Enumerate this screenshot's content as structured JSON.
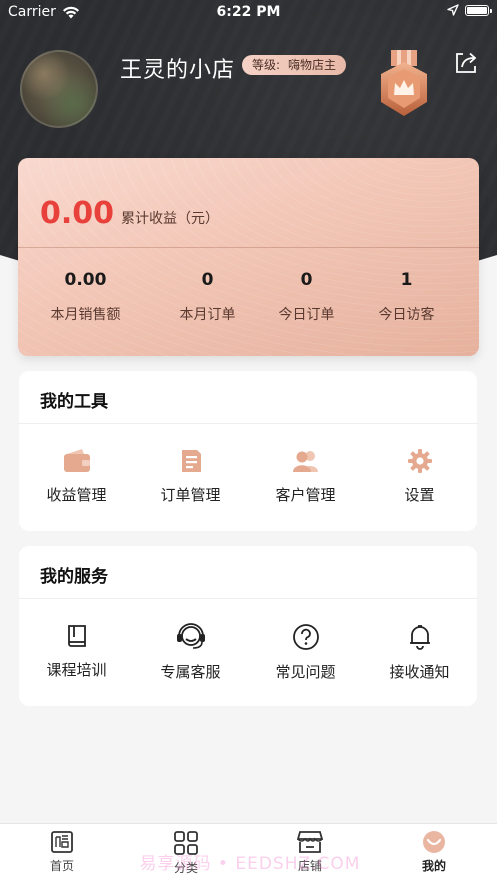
{
  "status_bar": {
    "carrier": "Carrier",
    "time": "6:22 PM"
  },
  "profile": {
    "shop_name": "王灵的小店",
    "level_label": "等级:",
    "level_value": "嗨物店主"
  },
  "earnings": {
    "total_value": "0.00",
    "total_label": "累计收益（元）",
    "stats": [
      {
        "value": "0.00",
        "label": "本月销售额"
      },
      {
        "value": "0",
        "label": "本月订单"
      },
      {
        "value": "0",
        "label": "今日订单"
      },
      {
        "value": "1",
        "label": "今日访客"
      }
    ]
  },
  "tools": {
    "title": "我的工具",
    "items": [
      {
        "label": "收益管理",
        "icon": "wallet-icon"
      },
      {
        "label": "订单管理",
        "icon": "order-document-icon"
      },
      {
        "label": "客户管理",
        "icon": "customers-icon"
      },
      {
        "label": "设置",
        "icon": "gear-icon"
      }
    ]
  },
  "services": {
    "title": "我的服务",
    "items": [
      {
        "label": "课程培训",
        "icon": "book-icon"
      },
      {
        "label": "专属客服",
        "icon": "headset-icon"
      },
      {
        "label": "常见问题",
        "icon": "question-icon"
      },
      {
        "label": "接收通知",
        "icon": "bell-icon"
      }
    ]
  },
  "tabbar": {
    "items": [
      {
        "label": "首页",
        "icon": "home-icon"
      },
      {
        "label": "分类",
        "icon": "grid-icon"
      },
      {
        "label": "店铺",
        "icon": "store-icon"
      },
      {
        "label": "我的",
        "icon": "profile-icon"
      }
    ],
    "active_index": 3
  },
  "watermark": "易享源码 • EEDSHZ.COM",
  "colors": {
    "accent_red": "#e8403a",
    "tool_icon": "#e4a98f",
    "header_dark": "#2c2d30",
    "card_peach": "#f2c6b6"
  }
}
